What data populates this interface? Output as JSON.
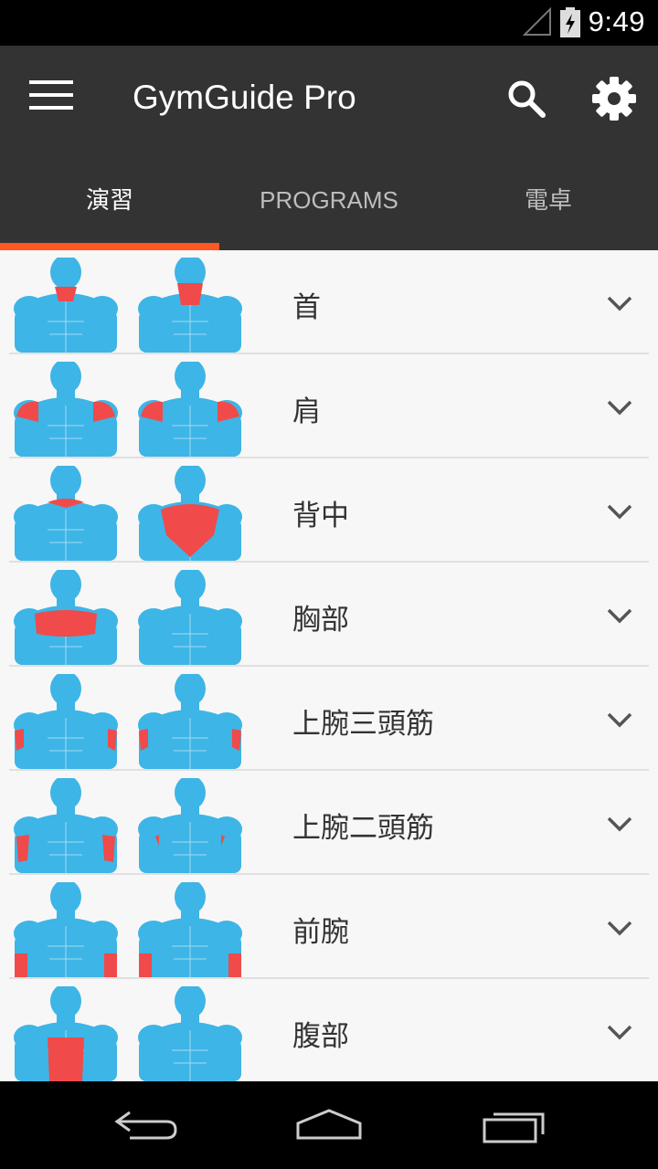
{
  "status_bar": {
    "time": "9:49"
  },
  "app_bar": {
    "title": "GymGuide Pro"
  },
  "tabs": [
    {
      "label": "演習",
      "active": true
    },
    {
      "label": "PROGRAMS",
      "active": false
    },
    {
      "label": "電卓",
      "active": false
    }
  ],
  "muscle_groups": [
    {
      "label": "首",
      "highlight": "neck"
    },
    {
      "label": "肩",
      "highlight": "shoulders"
    },
    {
      "label": "背中",
      "highlight": "back"
    },
    {
      "label": "胸部",
      "highlight": "chest"
    },
    {
      "label": "上腕三頭筋",
      "highlight": "triceps"
    },
    {
      "label": "上腕二頭筋",
      "highlight": "biceps"
    },
    {
      "label": "前腕",
      "highlight": "forearms"
    },
    {
      "label": "腹部",
      "highlight": "abs"
    }
  ],
  "colors": {
    "app_bar": "#333333",
    "accent": "#ff5722",
    "body": "#3db5e6",
    "highlight": "#f04a4a",
    "list_bg": "#f7f7f7"
  },
  "icons": [
    "menu-icon",
    "search-icon",
    "settings-icon",
    "chevron-down-icon",
    "back-icon",
    "home-icon",
    "recents-icon"
  ]
}
